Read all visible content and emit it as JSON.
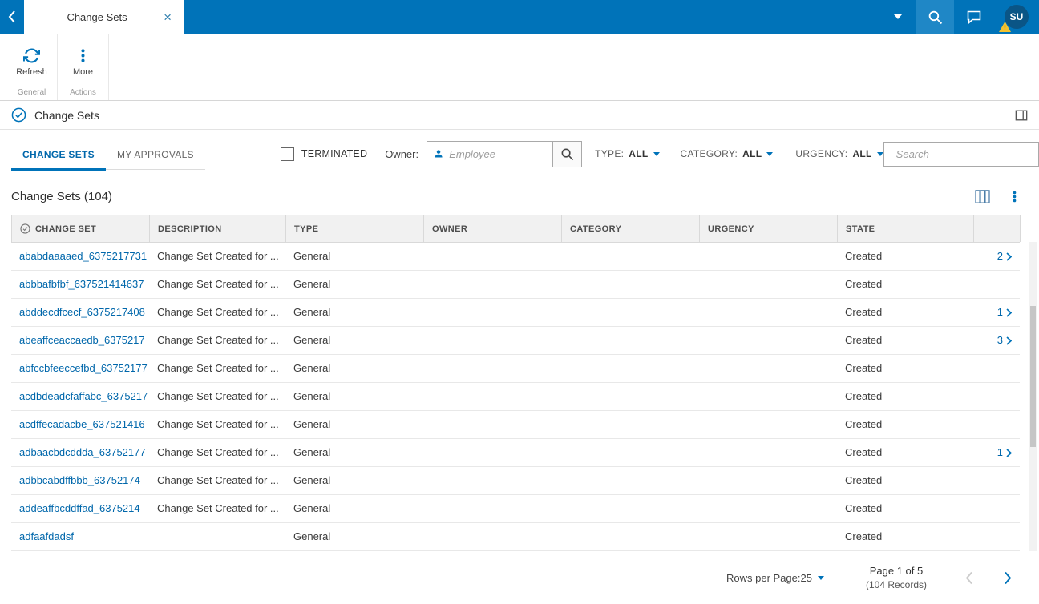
{
  "topbar": {
    "tab_title": "Change Sets",
    "close_label": "×",
    "avatar_initials": "SU",
    "warning_badge": "!"
  },
  "ribbon": {
    "refresh_label": "Refresh",
    "more_label": "More",
    "general_group": "General",
    "actions_group": "Actions"
  },
  "section": {
    "title": "Change Sets"
  },
  "tabs": [
    {
      "label": "CHANGE SETS"
    },
    {
      "label": "MY APPROVALS"
    }
  ],
  "filters": {
    "terminated": "TERMINATED",
    "owner_label": "Owner:",
    "employee_placeholder": "Employee",
    "type_label": "TYPE:",
    "type_value": "ALL",
    "category_label": "CATEGORY:",
    "category_value": "ALL",
    "urgency_label": "URGENCY:",
    "urgency_value": "ALL",
    "search_placeholder": "Search"
  },
  "list": {
    "heading": "Change Sets (104)"
  },
  "table": {
    "columns": [
      "CHANGE SET",
      "DESCRIPTION",
      "TYPE",
      "OWNER",
      "CATEGORY",
      "URGENCY",
      "STATE",
      ""
    ],
    "rows": [
      {
        "change_set": "ababdaaaaed_6375217731",
        "description": "Change Set Created for ...",
        "type": "General",
        "owner": "",
        "category": "",
        "urgency": "",
        "state": "Created",
        "count": "2"
      },
      {
        "change_set": "abbbafbfbf_637521414637",
        "description": "Change Set Created for ...",
        "type": "General",
        "owner": "",
        "category": "",
        "urgency": "",
        "state": "Created",
        "count": ""
      },
      {
        "change_set": "abddecdfcecf_6375217408",
        "description": "Change Set Created for ...",
        "type": "General",
        "owner": "",
        "category": "",
        "urgency": "",
        "state": "Created",
        "count": "1"
      },
      {
        "change_set": "abeaffceaccaedb_6375217",
        "description": "Change Set Created for ...",
        "type": "General",
        "owner": "",
        "category": "",
        "urgency": "",
        "state": "Created",
        "count": "3"
      },
      {
        "change_set": "abfccbfeeccefbd_63752177",
        "description": "Change Set Created for ...",
        "type": "General",
        "owner": "",
        "category": "",
        "urgency": "",
        "state": "Created",
        "count": ""
      },
      {
        "change_set": "acdbdeadcfaffabc_6375217",
        "description": "Change Set Created for ...",
        "type": "General",
        "owner": "",
        "category": "",
        "urgency": "",
        "state": "Created",
        "count": ""
      },
      {
        "change_set": "acdffecadacbe_637521416",
        "description": "Change Set Created for ...",
        "type": "General",
        "owner": "",
        "category": "",
        "urgency": "",
        "state": "Created",
        "count": ""
      },
      {
        "change_set": "adbaacbdcddda_63752177",
        "description": "Change Set Created for ...",
        "type": "General",
        "owner": "",
        "category": "",
        "urgency": "",
        "state": "Created",
        "count": "1"
      },
      {
        "change_set": "adbbcabdffbbb_63752174",
        "description": "Change Set Created for ...",
        "type": "General",
        "owner": "",
        "category": "",
        "urgency": "",
        "state": "Created",
        "count": ""
      },
      {
        "change_set": "addeaffbcddffad_6375214",
        "description": "Change Set Created for ...",
        "type": "General",
        "owner": "",
        "category": "",
        "urgency": "",
        "state": "Created",
        "count": ""
      },
      {
        "change_set": "adfaafdadsf",
        "description": "",
        "type": "General",
        "owner": "",
        "category": "",
        "urgency": "",
        "state": "Created",
        "count": ""
      }
    ]
  },
  "footer": {
    "rows_per_page_label": "Rows per Page:",
    "rows_per_page_value": "25",
    "page_info": "Page 1 of 5",
    "records_info": "(104 Records)"
  }
}
